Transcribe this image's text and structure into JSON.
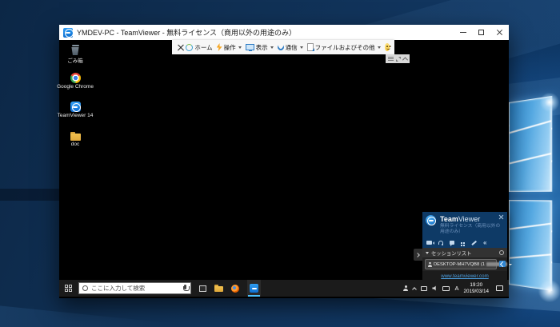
{
  "window": {
    "title": "YMDEV-PC - TeamViewer - 無料ライセンス（商用以外の用途のみ）"
  },
  "toolbar": {
    "home": "ホーム",
    "actions": "操作",
    "view": "表示",
    "comm": "通信",
    "files": "ファイルおよびその他"
  },
  "desktop_icons": [
    {
      "label": "ごみ箱"
    },
    {
      "label": "Google Chrome"
    },
    {
      "label": "TeamViewer 14"
    },
    {
      "label": "doc"
    }
  ],
  "taskbar": {
    "search_placeholder": "ここに入力して検索",
    "tray": {
      "ime": "A",
      "time": "19:20",
      "date": "2019/03/14"
    }
  },
  "panel": {
    "brand_team": "Team",
    "brand_viewer": "Viewer",
    "license_line1": "無料ライセンス（商用以外の",
    "license_line2": "用途のみ）",
    "session_list_label": "セッションリスト",
    "session_entry": "DESKTOP-MH7VQB8 (1",
    "link": "www.teamviewer.com"
  },
  "colors": {
    "teamviewer_blue": "#0e6fd0",
    "panel_navy": "#0e3a66",
    "taskbar_dark": "#1b1b1b",
    "accent_underline": "#4cc2ff"
  }
}
